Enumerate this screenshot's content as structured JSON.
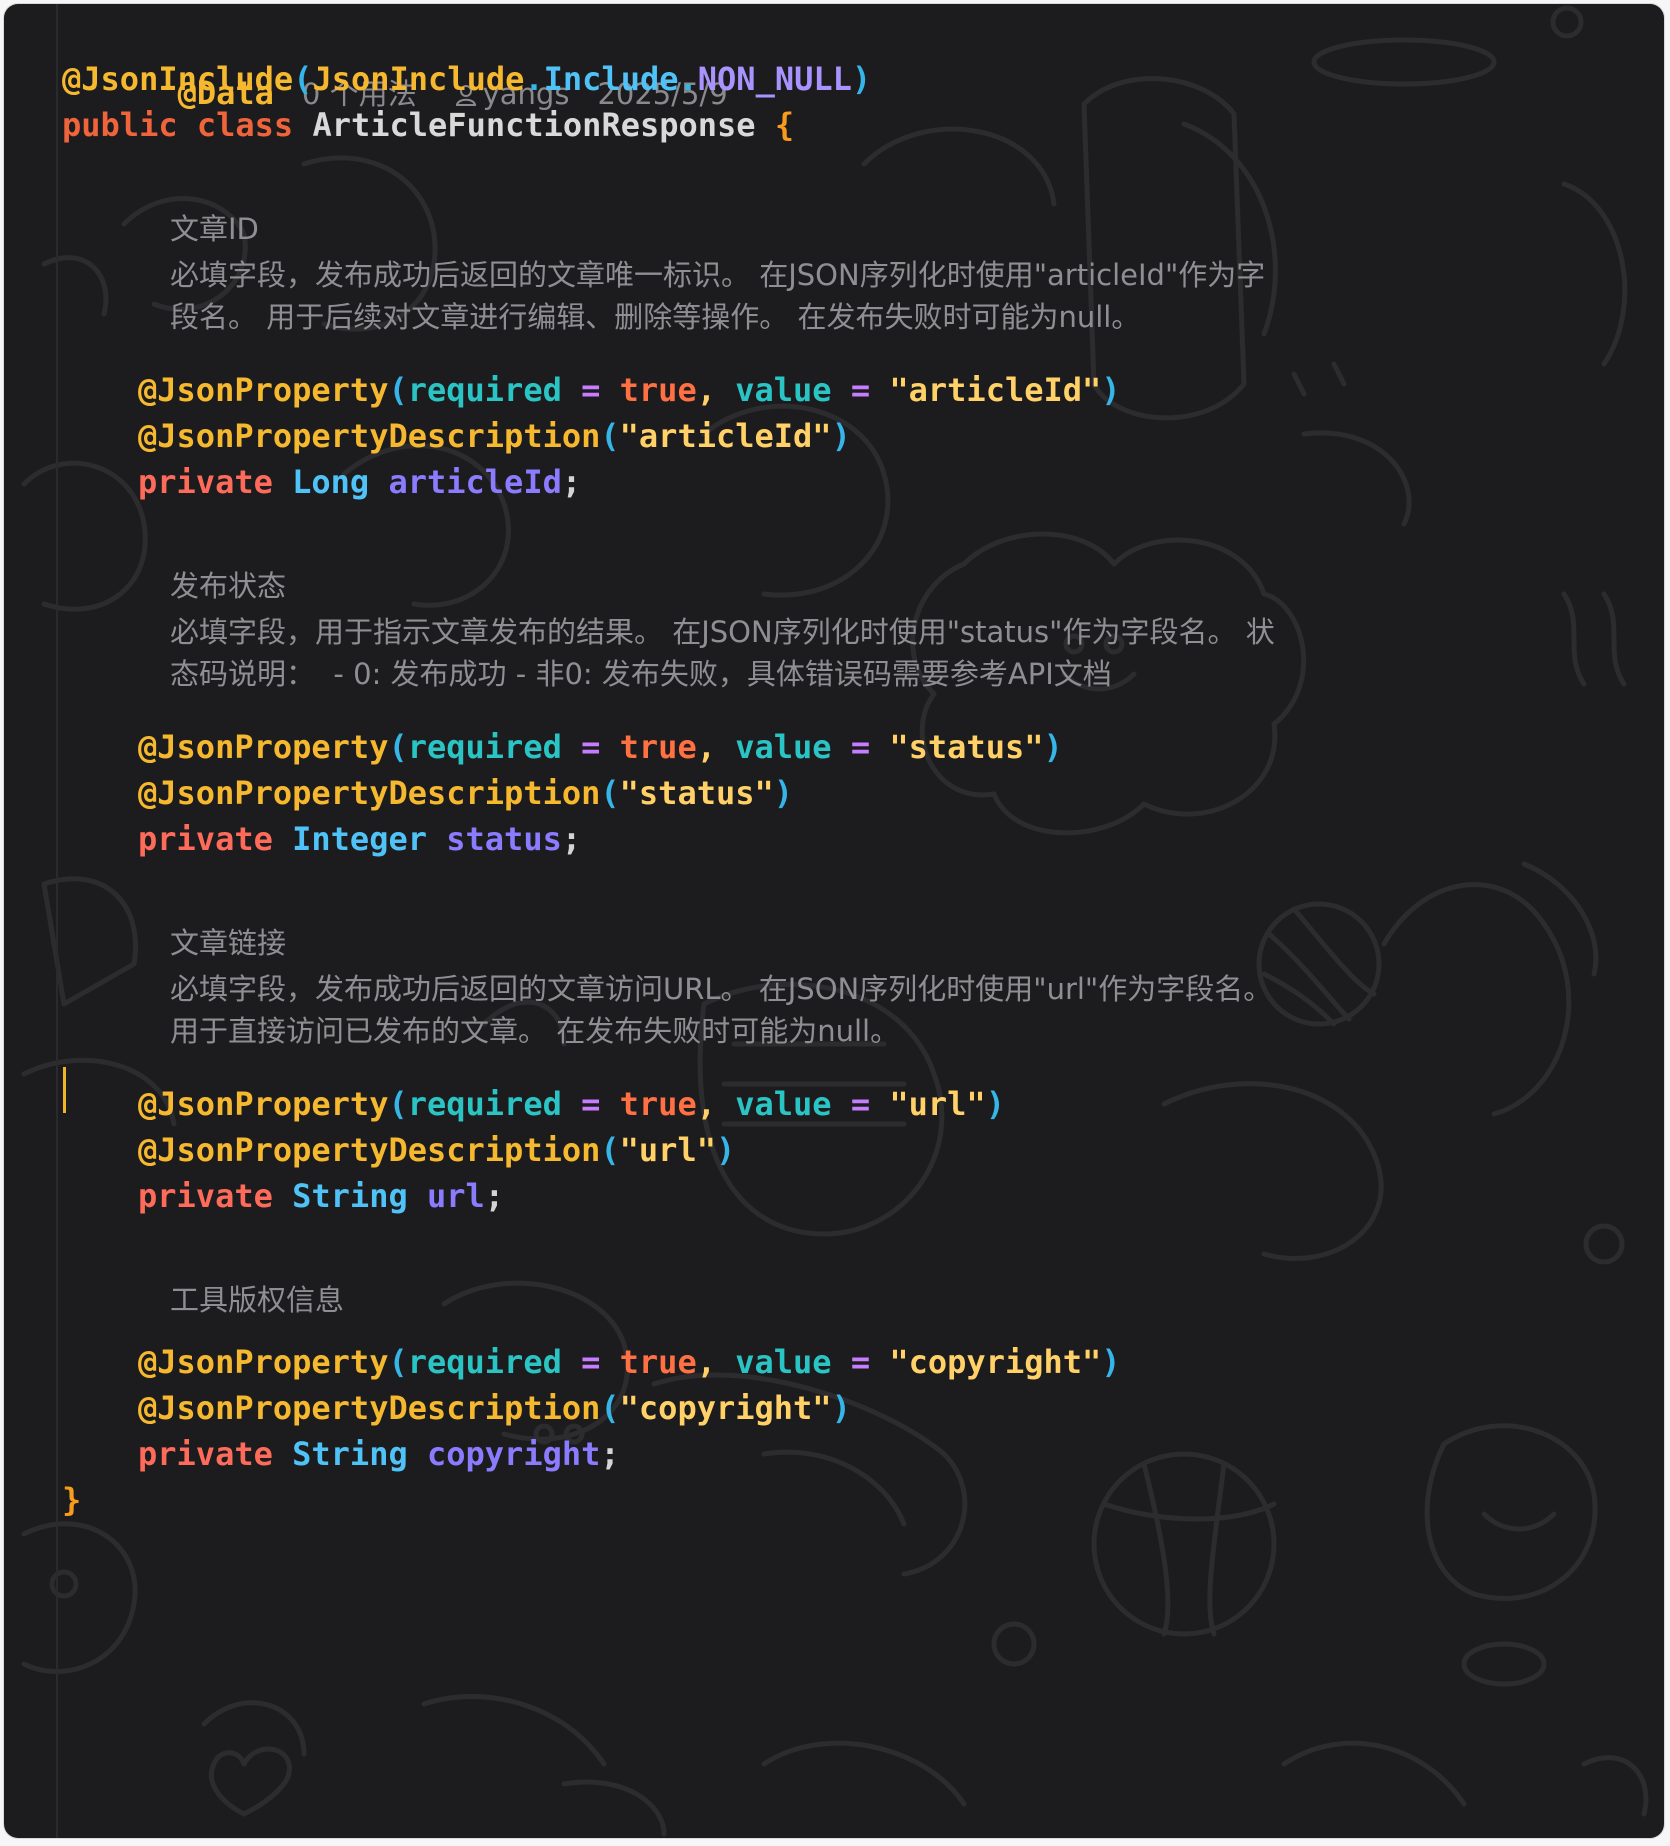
{
  "header": {
    "annotation": "@Data",
    "usages_hint": "0 个用法",
    "author": "yangs",
    "date": "2025/5/9"
  },
  "class_decl": {
    "annotation": "@JsonInclude",
    "open_paren": "(",
    "include_class": "JsonInclude",
    "dot1": ".",
    "include_enum": "Include",
    "dot2": ".",
    "include_value": "NON_NULL",
    "close_paren": ")",
    "kw_public": "public",
    "kw_class": "class",
    "class_name": "ArticleFunctionResponse",
    "open_brace": "{",
    "close_brace": "}"
  },
  "fields": [
    {
      "doc_title": "文章ID",
      "doc_lines": [
        "必填字段，发布成功后返回的文章唯一标识。 在JSON序列化时使用\"articleId\"作为字",
        "段名。 用于后续对文章进行编辑、删除等操作。 在发布失败时可能为null。"
      ],
      "prop_annotation": "@JsonProperty",
      "open_paren": "(",
      "required_key": "required",
      "eq": "=",
      "required_val": "true",
      "comma": ",",
      "value_key": "value",
      "value_str": "\"articleId\"",
      "close_paren": ")",
      "desc_annotation": "@JsonPropertyDescription",
      "desc_str": "\"articleId\"",
      "kw_private": "private",
      "type": "Long",
      "name": "articleId",
      "semi": ";"
    },
    {
      "doc_title": "发布状态",
      "doc_lines": [
        "必填字段，用于指示文章发布的结果。 在JSON序列化时使用\"status\"作为字段名。 状",
        "态码说明：  - 0: 发布成功 - 非0: 发布失败，具体错误码需要参考API文档"
      ],
      "prop_annotation": "@JsonProperty",
      "open_paren": "(",
      "required_key": "required",
      "eq": "=",
      "required_val": "true",
      "comma": ",",
      "value_key": "value",
      "value_str": "\"status\"",
      "close_paren": ")",
      "desc_annotation": "@JsonPropertyDescription",
      "desc_str": "\"status\"",
      "kw_private": "private",
      "type": "Integer",
      "name": "status",
      "semi": ";"
    },
    {
      "doc_title": "文章链接",
      "doc_lines": [
        "必填字段，发布成功后返回的文章访问URL。 在JSON序列化时使用\"url\"作为字段名。",
        "用于直接访问已发布的文章。 在发布失败时可能为null。"
      ],
      "prop_annotation": "@JsonProperty",
      "open_paren": "(",
      "required_key": "required",
      "eq": "=",
      "required_val": "true",
      "comma": ",",
      "value_key": "value",
      "value_str": "\"url\"",
      "close_paren": ")",
      "desc_annotation": "@JsonPropertyDescription",
      "desc_str": "\"url\"",
      "kw_private": "private",
      "type": "String",
      "name": "url",
      "semi": ";"
    },
    {
      "doc_title": "工具版权信息",
      "doc_lines": [],
      "prop_annotation": "@JsonProperty",
      "open_paren": "(",
      "required_key": "required",
      "eq": "=",
      "required_val": "true",
      "comma": ",",
      "value_key": "value",
      "value_str": "\"copyright\"",
      "close_paren": ")",
      "desc_annotation": "@JsonPropertyDescription",
      "desc_str": "\"copyright\"",
      "kw_private": "private",
      "type": "String",
      "name": "copyright",
      "semi": ";"
    }
  ],
  "icons": {
    "author_icon": "user-icon"
  },
  "colors": {
    "background": "#1c1c1e",
    "annotation": "#f5b82e",
    "keyword": "#f0643c",
    "type": "#4fc3f7",
    "field": "#8b7cff",
    "string": "#ffd166",
    "param": "#2bc4c4",
    "comment": "#8f8f93",
    "caret": "#f0b429"
  }
}
